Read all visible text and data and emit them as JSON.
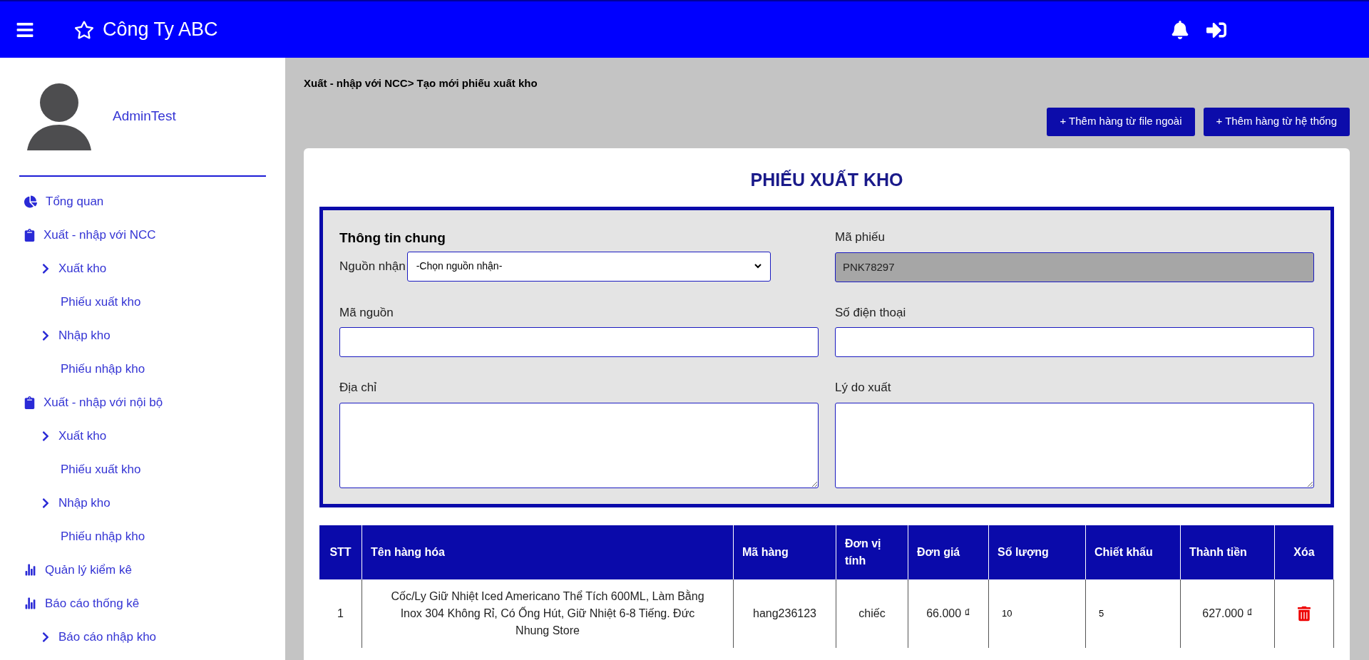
{
  "topbar": {
    "title": "Công Ty ABC"
  },
  "sidebar": {
    "user": "AdminTest",
    "items": [
      {
        "label": "Tổng quan",
        "kind": "overview"
      },
      {
        "label": "Xuất - nhập với NCC",
        "kind": "transfer",
        "children": [
          {
            "label": "Xuất kho",
            "children": [
              {
                "label": "Phiếu xuất kho"
              }
            ]
          },
          {
            "label": "Nhập kho",
            "children": [
              {
                "label": "Phiếu nhập kho"
              }
            ]
          }
        ]
      },
      {
        "label": "Xuất - nhập với nội bộ",
        "kind": "transfer",
        "children": [
          {
            "label": "Xuất kho",
            "children": [
              {
                "label": "Phiếu xuất kho"
              }
            ]
          },
          {
            "label": "Nhập kho",
            "children": [
              {
                "label": "Phiếu nhập kho"
              }
            ]
          }
        ]
      },
      {
        "label": "Quản lý kiểm kê",
        "kind": "report"
      },
      {
        "label": "Báo cáo thống kê",
        "kind": "report",
        "children": [
          {
            "label": "Báo cáo nhập kho"
          }
        ]
      }
    ]
  },
  "breadcrumb": "Xuất - nhập với NCC> Tạo mới phiếu xuất kho",
  "actions": [
    "+ Thêm hàng từ file ngoài",
    "+ Thêm hàng từ hệ thống"
  ],
  "form": {
    "title": "PHIẾU XUẤT KHO",
    "section": "Thông tin chung",
    "source": {
      "label": "Nguồn nhận",
      "value": "-Chọn nguồn nhận-"
    },
    "fields": [
      {
        "kind": "input",
        "label": "Mã phiếu",
        "value": "PNK78297",
        "disabled": true
      },
      {
        "kind": "input",
        "label": "Mã nguồn",
        "disabled": false
      },
      {
        "kind": "input",
        "label": "Số điện thoại",
        "disabled": false
      },
      {
        "kind": "textarea",
        "label": "Địa chỉ",
        "disabled": false
      },
      {
        "kind": "textarea",
        "label": "Lý do xuất",
        "disabled": false
      }
    ]
  },
  "table": {
    "columns": [
      "STT",
      "Tên hàng hóa",
      "Mã hàng",
      "Đơn vị tính",
      "Đơn giá",
      "Số lượng",
      "Chiết khấu",
      "Thành tiền",
      "Xóa"
    ],
    "rows": [
      [
        {
          "kind": "text",
          "text": "1"
        },
        {
          "kind": "text",
          "text": "Cốc/Ly Giữ Nhiệt Iced Americano Thể Tích 600ML, Làm Bằng Inox 304 Không Rỉ, Có Ống Hút, Giữ Nhiệt 6-8 Tiếng. Đức Nhung Store"
        },
        {
          "kind": "text",
          "text": "hang236123"
        },
        {
          "kind": "text",
          "text": "chiếc"
        },
        {
          "kind": "text",
          "text": "66.000 ₫"
        },
        {
          "kind": "input",
          "text": "10"
        },
        {
          "kind": "input",
          "text": "5"
        },
        {
          "kind": "text",
          "text": "627.000 ₫"
        },
        {
          "kind": "delete"
        }
      ]
    ]
  }
}
